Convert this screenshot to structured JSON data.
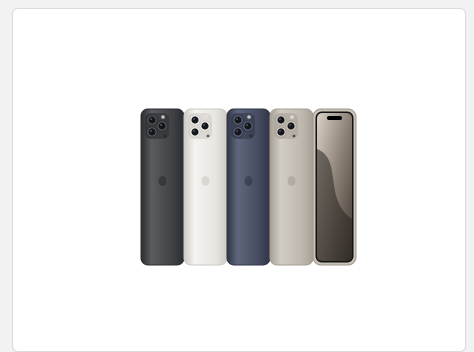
{
  "card": {
    "image": {
      "subject": "iphone-15-pro-lineup",
      "finishes": [
        {
          "name": "black-titanium",
          "hex": "#3f4043",
          "shade": "#2b2c2f",
          "light": "#5b5c60"
        },
        {
          "name": "white-titanium",
          "hex": "#e7e5e0",
          "shade": "#cdcac4",
          "light": "#f4f3f0"
        },
        {
          "name": "blue-titanium",
          "hex": "#444b5e",
          "shade": "#2f3546",
          "light": "#5f677d"
        },
        {
          "name": "natural-titanium",
          "hex": "#bdb7ad",
          "shade": "#a59f95",
          "light": "#d2cdc4"
        }
      ],
      "front_view_frame_hex": "#c8c2b8",
      "wallpaper_hex": "#8a7f74"
    }
  }
}
